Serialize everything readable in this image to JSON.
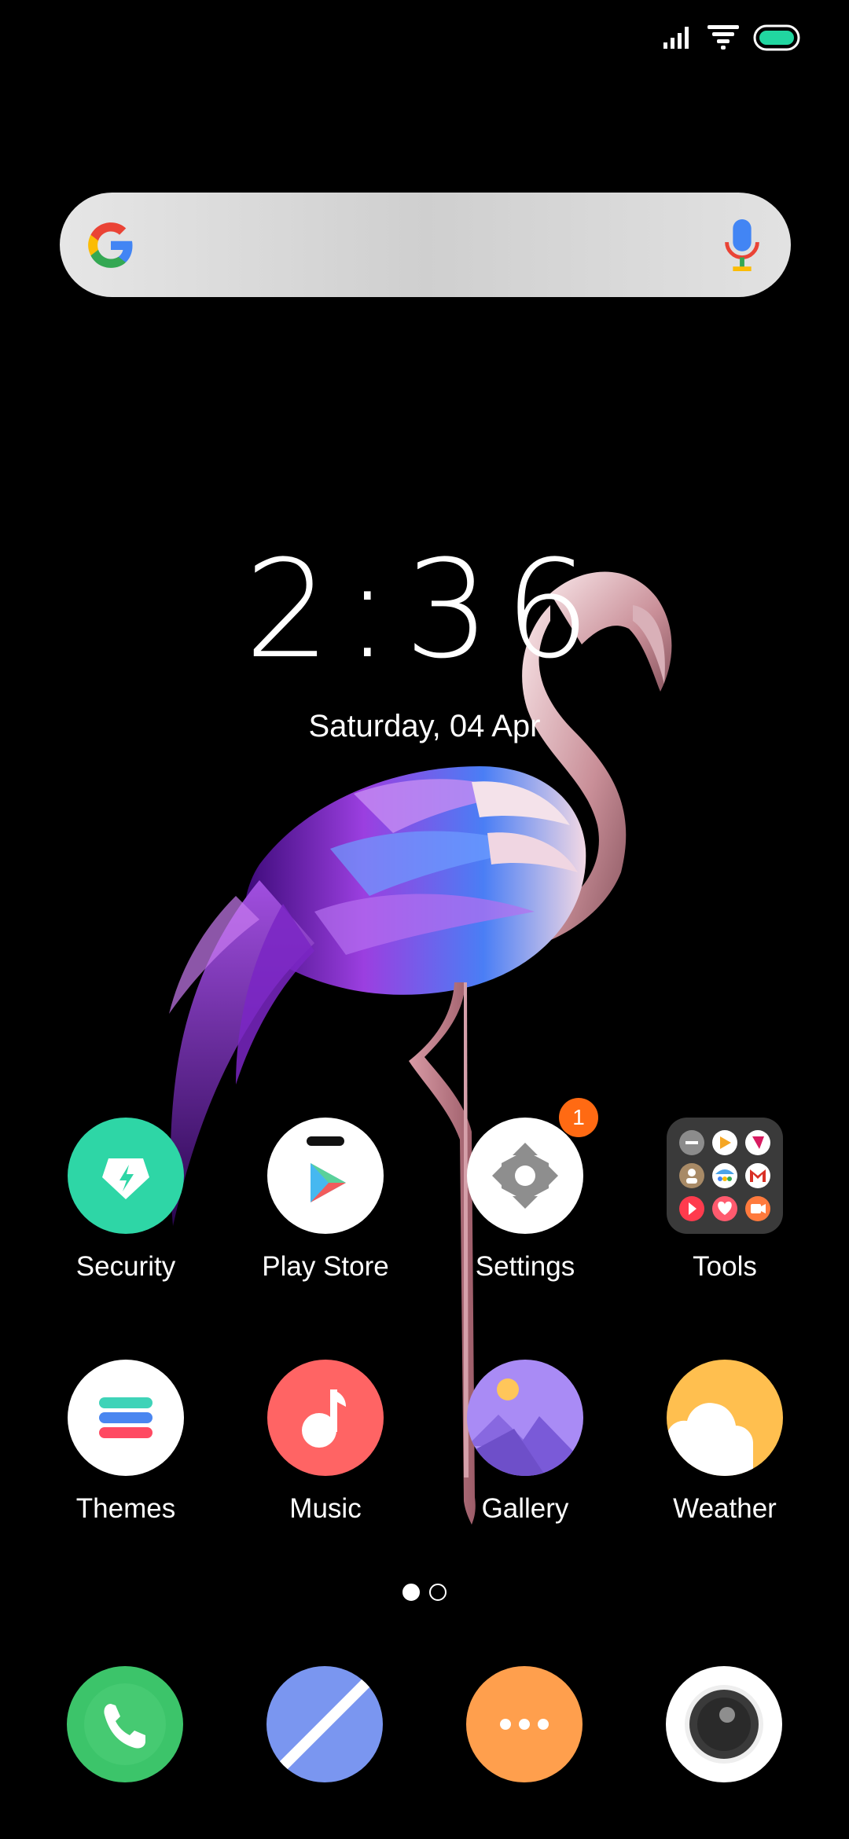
{
  "status_bar": {
    "icons": [
      "signal-icon",
      "wifi-icon",
      "battery-icon"
    ],
    "battery_color": "#21d6a0"
  },
  "search_bar": {
    "logo": "google-logo-icon",
    "mic": "mic-icon",
    "placeholder": ""
  },
  "clock": {
    "time": "2:36",
    "date": "Saturday, 04 Apr"
  },
  "apps": [
    {
      "label": "Security",
      "icon": "security-icon",
      "color": "#2ed6a6"
    },
    {
      "label": "Play Store",
      "icon": "play-store-icon",
      "color": "#ffffff"
    },
    {
      "label": "Settings",
      "icon": "settings-gear-icon",
      "color": "#ffffff",
      "badge": "1"
    },
    {
      "label": "Tools",
      "icon": "tools-folder-icon",
      "color": "#3a3a3a"
    },
    {
      "label": "Themes",
      "icon": "themes-icon",
      "color": "#ffffff"
    },
    {
      "label": "Music",
      "icon": "music-note-icon",
      "color": "#ff6464"
    },
    {
      "label": "Gallery",
      "icon": "gallery-icon",
      "color": "#9b7ef0"
    },
    {
      "label": "Weather",
      "icon": "weather-icon",
      "color": "#ffbf4f"
    }
  ],
  "page_indicator": {
    "pages": 2,
    "active": 1
  },
  "dock": [
    {
      "icon": "phone-icon",
      "color": "#3cc46a"
    },
    {
      "icon": "browser-icon",
      "color": "#7a96f0"
    },
    {
      "icon": "messages-icon",
      "color": "#ff9f4d"
    },
    {
      "icon": "camera-icon",
      "color": "#ffffff"
    }
  ]
}
